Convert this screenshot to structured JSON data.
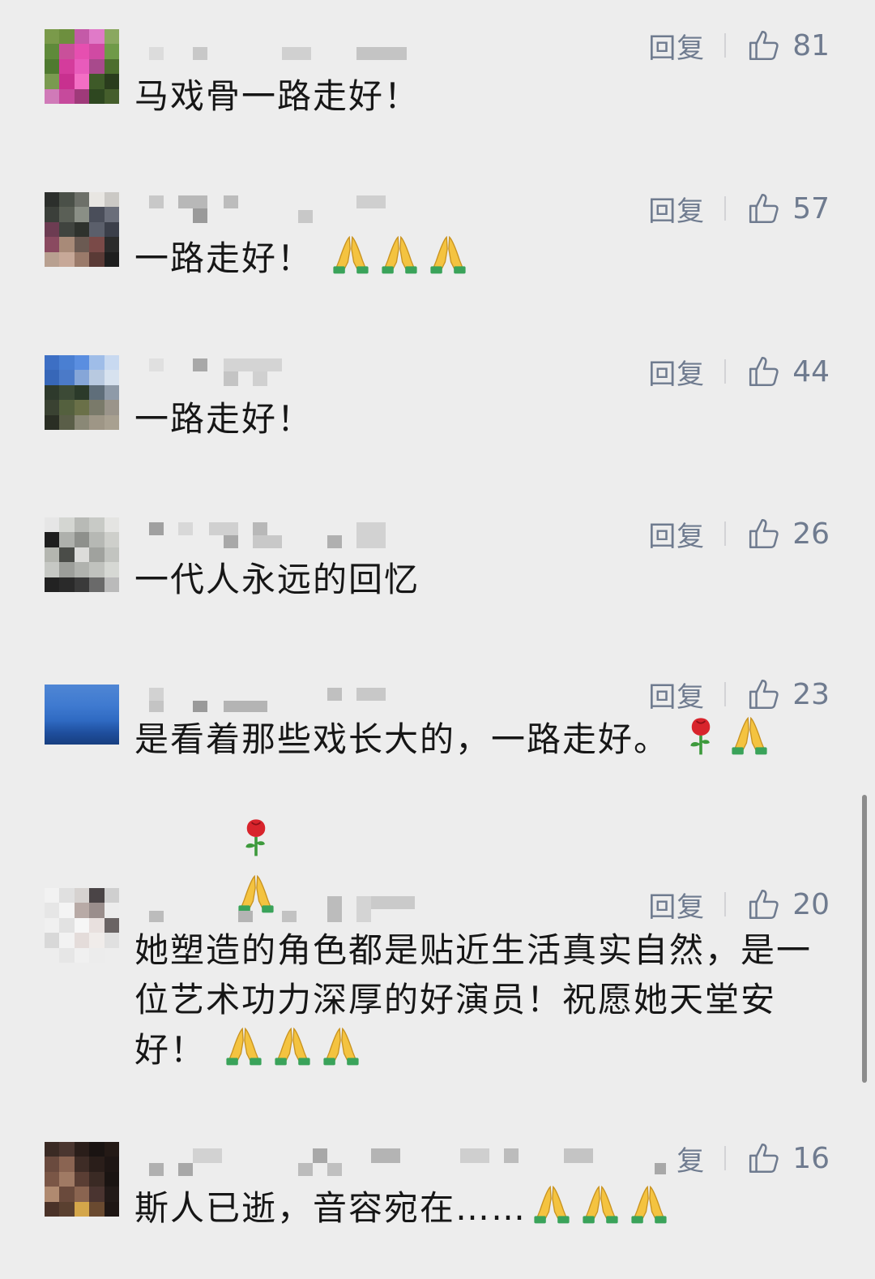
{
  "reply_label": "回复",
  "comments": [
    {
      "text": "马戏骨一路走好！",
      "likes": "81"
    },
    {
      "text": "一路走好！",
      "likes": "57",
      "emojis": [
        "pray-emoji",
        "pray-emoji",
        "pray-emoji"
      ]
    },
    {
      "text": "一路走好！",
      "likes": "44"
    },
    {
      "text": "一代人永远的回忆",
      "likes": "26"
    },
    {
      "text": "是看着那些戏长大的，一路走好。",
      "likes": "23",
      "emojis": [
        "rose-emoji",
        "pray-emoji"
      ],
      "emojis_line2": [
        "rose-emoji",
        "pray-emoji"
      ]
    },
    {
      "text": "她塑造的角色都是贴近生活真实自然，是一位艺术功力深厚的好演员！祝愿她天堂安好！",
      "likes": "20",
      "emojis": [
        "pray-emoji",
        "pray-emoji",
        "pray-emoji"
      ]
    },
    {
      "text": "斯人已逝，音容宛在……",
      "likes": "16",
      "reply_partial": "复",
      "emojis": [
        "pray-emoji",
        "pray-emoji",
        "pray-emoji"
      ]
    }
  ],
  "colors": {
    "background": "#ededed",
    "meta_text": "#6f7b8f",
    "body_text": "#161616"
  }
}
